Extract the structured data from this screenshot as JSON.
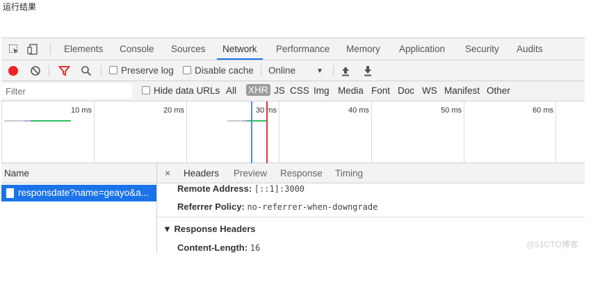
{
  "caption": "运行结果",
  "tabs": [
    "Elements",
    "Console",
    "Sources",
    "Network",
    "Performance",
    "Memory",
    "Application",
    "Security",
    "Audits"
  ],
  "active_tab": "Network",
  "network_toolbar": {
    "preserve_log": "Preserve log",
    "disable_cache": "Disable cache",
    "throttle": "Online",
    "throttle_arrow": "▼",
    "upload_icon": "⭱",
    "download_icon": "⭳"
  },
  "filter": {
    "placeholder": "Filter",
    "hide_data_urls": "Hide data URLs",
    "types": [
      "All",
      "XHR",
      "JS",
      "CSS",
      "Img",
      "Media",
      "Font",
      "Doc",
      "WS",
      "Manifest",
      "Other"
    ],
    "selected_type": "XHR"
  },
  "timeline": {
    "ticks": [
      "10 ms",
      "20 ms",
      "30 ms",
      "40 ms",
      "50 ms",
      "60 ms"
    ]
  },
  "requests": {
    "column_header": "Name",
    "rows": [
      "responsdate?name=geayo&a..."
    ]
  },
  "details": {
    "close": "×",
    "tabs": [
      "Headers",
      "Preview",
      "Response",
      "Timing"
    ],
    "active_tab": "Headers",
    "remote_address_key": "Remote Address:",
    "remote_address_value": "[::1]:3000",
    "referrer_policy_key": "Referrer Policy:",
    "referrer_policy_value": "no-referrer-when-downgrade",
    "response_headers_title": "▼ Response Headers",
    "content_length_key": "Content-Length:",
    "content_length_value": "16"
  },
  "watermark": "@51CTO博客",
  "colors": {
    "accent": "#1a73e8",
    "record": "#e22222",
    "filter_icon": "#e22222"
  }
}
